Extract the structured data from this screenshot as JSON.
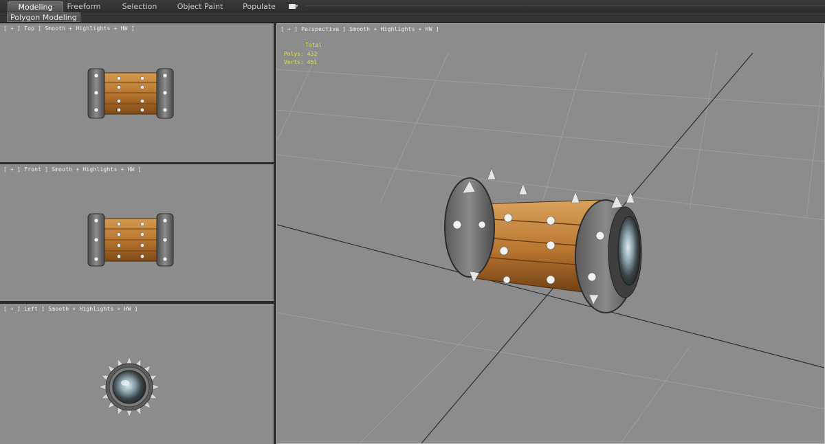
{
  "ribbon": {
    "tabs": [
      {
        "label": "Modeling",
        "active": true
      },
      {
        "label": "Freeform",
        "active": false
      },
      {
        "label": "Selection",
        "active": false
      },
      {
        "label": "Object Paint",
        "active": false
      },
      {
        "label": "Populate",
        "active": false
      }
    ],
    "panel_button": "Polygon Modeling"
  },
  "viewports": {
    "top": {
      "label": "[ + ] Top ] Smooth + Highlights + HW ]"
    },
    "front": {
      "label": "[ + ] Front ] Smooth + Highlights + HW ]"
    },
    "left": {
      "label": "[ + ] Left ] Smooth + Highlights + HW ]"
    },
    "perspective": {
      "label": "[ + ] Perspective ] Smooth + Highlights + HW ]",
      "stats": {
        "total_label": "Total",
        "polys": "Polys: 432",
        "verts": "Verts: 451"
      }
    }
  },
  "colors": {
    "viewport_bg": "#8c8c8c",
    "stats_text": "#e3e14a",
    "wood": "#b9762e",
    "metal": "#6e6e6e"
  }
}
